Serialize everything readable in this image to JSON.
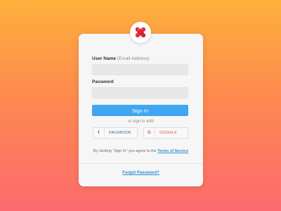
{
  "colors": {
    "background_top": "#fdb03c",
    "background_bottom": "#fd6a6e",
    "card": "#f6f6f6",
    "primary_button": "#3ea6f2",
    "link": "#2f8fd6",
    "facebook": "#3b5998",
    "google": "#dd4b39",
    "logo_mark": "#e5323f"
  },
  "logo": {
    "icon": "x-logo-icon"
  },
  "form": {
    "username_label": "User Name",
    "username_hint": "(Email Address)",
    "username_value": "",
    "password_label": "Password",
    "password_value": "",
    "signin_label": "Sign In",
    "or_text": "or sign in with"
  },
  "social": {
    "facebook_icon_glyph": "f",
    "facebook_label": "FACEBOOK",
    "google_icon_glyph": "G",
    "google_label": "GOOGLE"
  },
  "terms": {
    "prefix": "By clicking \"Sign In\" you agree to the",
    "link_label": "Terms of Service"
  },
  "footer": {
    "forgot_label": "Forgot Password?"
  }
}
